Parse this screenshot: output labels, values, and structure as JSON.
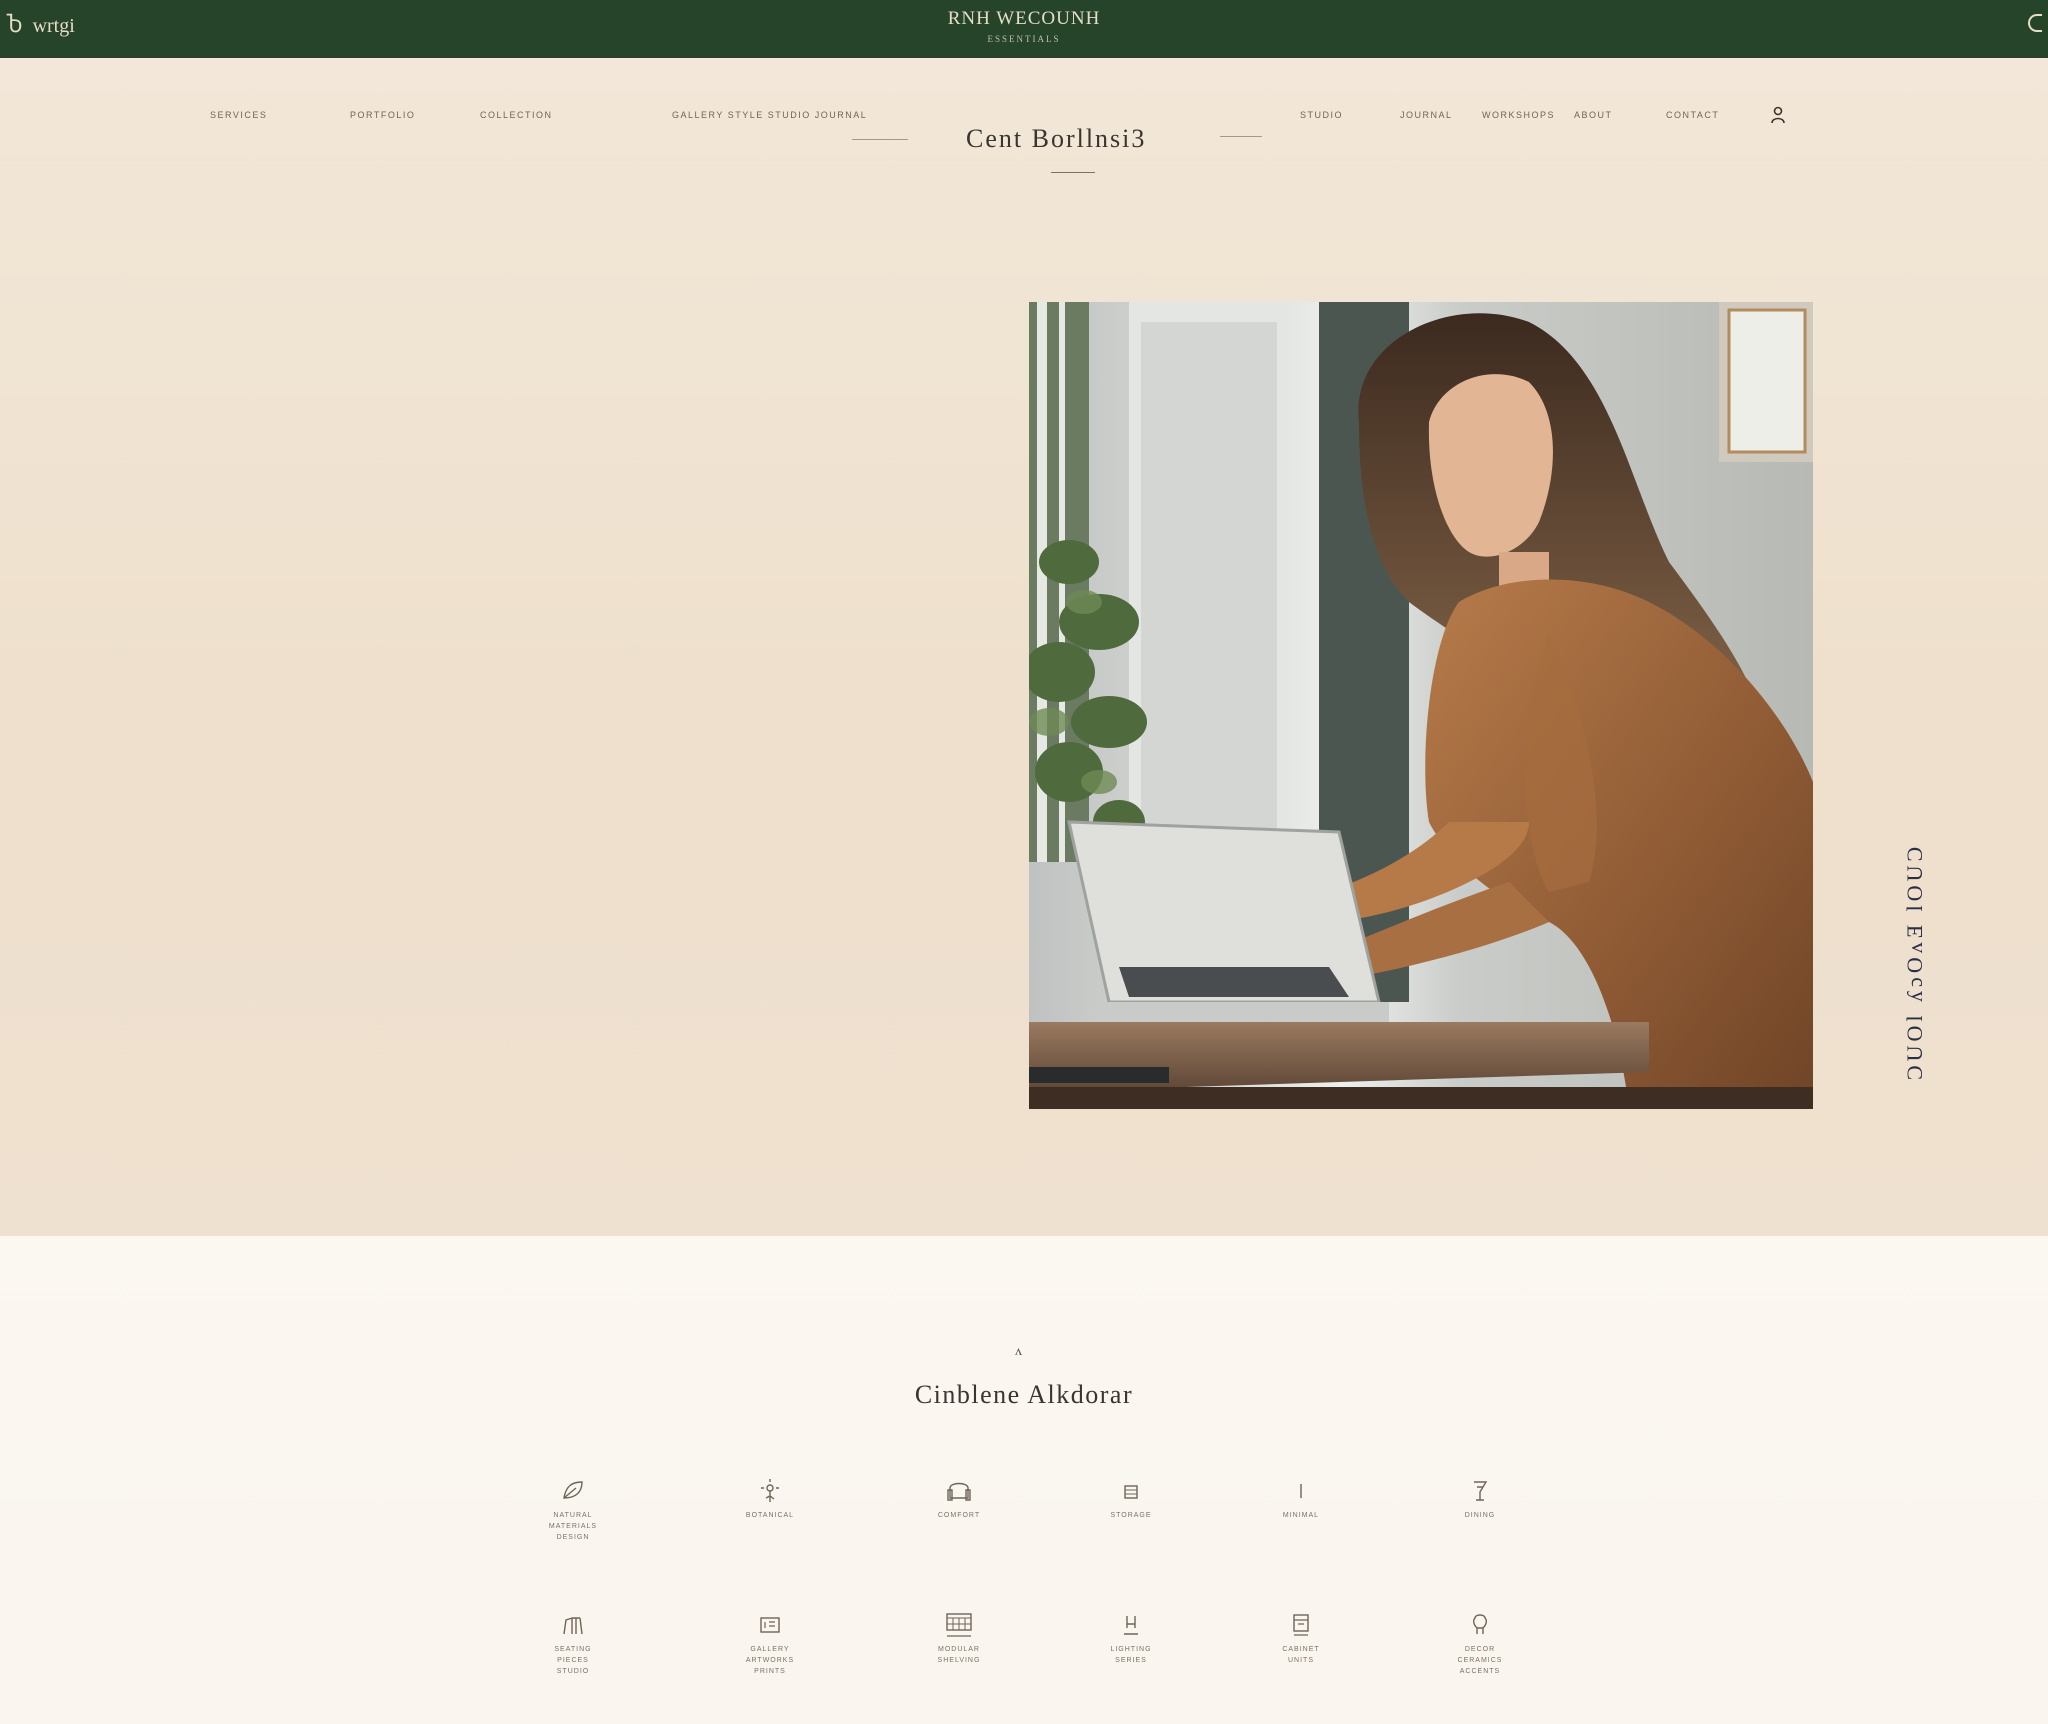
{
  "topbar": {
    "left_glyph": "Ⴆ",
    "left_text": "wrtgi",
    "title": "RNH WECOUNH",
    "subtitle": "ESSENTIALS"
  },
  "nav": {
    "left": [
      "Services",
      "Portfolio",
      "Collection",
      "Gallery Style Studio Journal"
    ],
    "right": [
      "Studio",
      "Journal",
      "Workshops",
      "About",
      "Contact"
    ]
  },
  "brand": "Cent Borllnsi3",
  "hero": {
    "vertical_text": "ƆUOl ʎɔOʌƎ lOUƆ"
  },
  "section": {
    "caret": "ʌ",
    "title": "Cinblene Alkdorar",
    "features_row1": [
      {
        "icon": "leaf-icon",
        "lines": [
          "Natural",
          "Materials",
          "Design"
        ]
      },
      {
        "icon": "flower-icon",
        "lines": [
          "Botanical"
        ]
      },
      {
        "icon": "armchair-icon",
        "lines": [
          "Comfort"
        ]
      },
      {
        "icon": "box-icon",
        "lines": [
          "Storage"
        ]
      },
      {
        "icon": "line-icon",
        "lines": [
          "Minimal"
        ]
      },
      {
        "icon": "glass-icon",
        "lines": [
          "Dining"
        ]
      }
    ],
    "features_row2": [
      {
        "icon": "chair-icon",
        "lines": [
          "Seating",
          "Pieces",
          "Studio"
        ]
      },
      {
        "icon": "frame-icon",
        "lines": [
          "Gallery",
          "Artworks",
          "Prints"
        ]
      },
      {
        "icon": "grid-icon",
        "lines": [
          "Modular",
          "Shelving"
        ]
      },
      {
        "icon": "lamp-icon",
        "lines": [
          "Lighting",
          "Series"
        ]
      },
      {
        "icon": "cabinet-icon",
        "lines": [
          "Cabinet",
          "Units"
        ]
      },
      {
        "icon": "vase-icon",
        "lines": [
          "Decor",
          "Ceramics",
          "Accents"
        ]
      }
    ]
  }
}
